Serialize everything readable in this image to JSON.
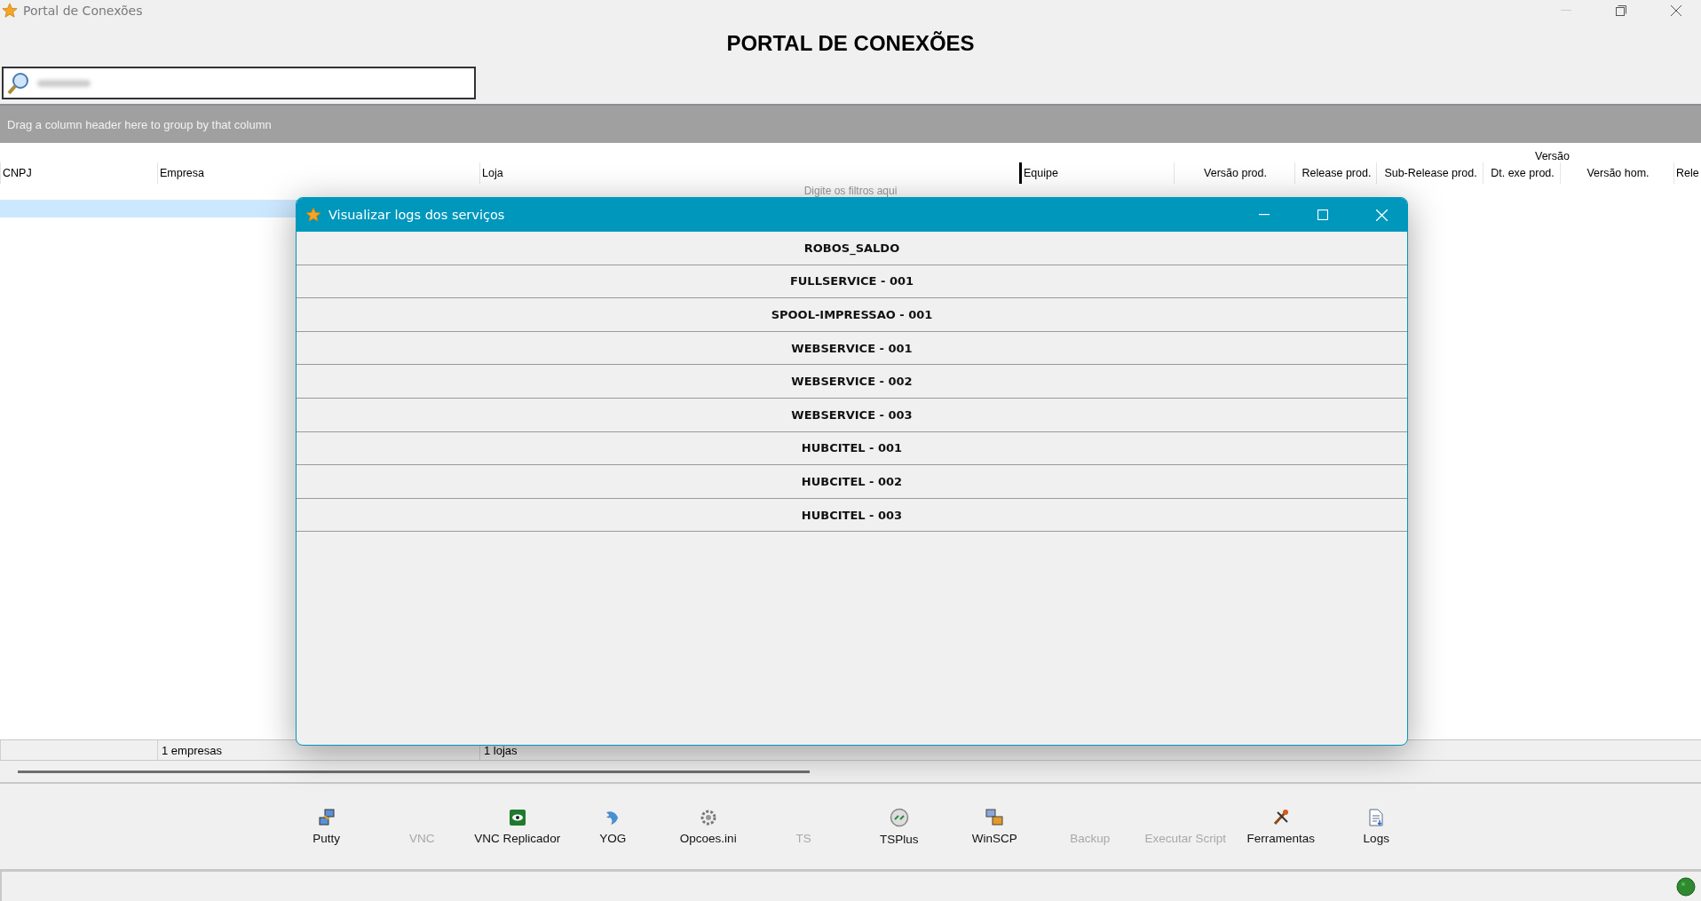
{
  "window": {
    "title": "Portal de Conexões"
  },
  "heading": "PORTAL DE CONEXÕES",
  "group_panel": {
    "hint": "Drag a column header here to group by that column"
  },
  "grid": {
    "band": "Versão",
    "columns": [
      "CNPJ",
      "Empresa",
      "Loja",
      "Equipe",
      "Versão prod.",
      "Release prod.",
      "Sub-Release prod.",
      "Dt. exe prod.",
      "Versão hom.",
      "Rele"
    ],
    "filter_hint": "Digite os filtros aqui",
    "summary": [
      "1 empresas",
      "1 lojas"
    ]
  },
  "dialog": {
    "title": "Visualizar logs dos serviços",
    "items": [
      "ROBOS_SALDO",
      "FULLSERVICE - 001",
      "SPOOL-IMPRESSAO - 001",
      "WEBSERVICE - 001",
      "WEBSERVICE - 002",
      "WEBSERVICE - 003",
      "HUBCITEL - 001",
      "HUBCITEL - 002",
      "HUBCITEL - 003"
    ]
  },
  "toolbar": [
    {
      "label": "Putty",
      "kind": "putty",
      "disabled": false
    },
    {
      "label": "VNC",
      "kind": "blank",
      "disabled": true
    },
    {
      "label": "VNC Replicador",
      "kind": "eye",
      "disabled": false
    },
    {
      "label": "YOG",
      "kind": "dolphin",
      "disabled": false
    },
    {
      "label": "Opcoes.ini",
      "kind": "gear",
      "disabled": false
    },
    {
      "label": "TS",
      "kind": "blank",
      "disabled": true
    },
    {
      "label": "TSPlus",
      "kind": "remote",
      "disabled": false
    },
    {
      "label": "WinSCP",
      "kind": "transfer",
      "disabled": false
    },
    {
      "label": "Backup",
      "kind": "blank",
      "disabled": true
    },
    {
      "label": "Executar Script",
      "kind": "blank",
      "disabled": true
    },
    {
      "label": "Ferramentas",
      "kind": "tools",
      "disabled": false
    },
    {
      "label": "Logs",
      "kind": "document",
      "disabled": false
    }
  ]
}
